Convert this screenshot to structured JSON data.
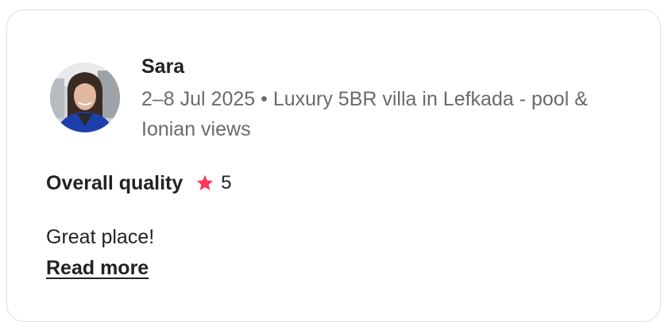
{
  "review": {
    "reviewer_name": "Sara",
    "stay_info": "2–8 Jul 2025 • Luxury 5BR villa in Lefkada - pool & Ionian views",
    "rating_label": "Overall quality",
    "rating_value": "5",
    "rating_icon": "star-icon",
    "review_text": "Great place!",
    "read_more_label": "Read more"
  },
  "colors": {
    "star": "#FF385C",
    "text_primary": "#222222",
    "text_secondary": "#6A6A6A",
    "card_border": "#DDDDDD"
  }
}
